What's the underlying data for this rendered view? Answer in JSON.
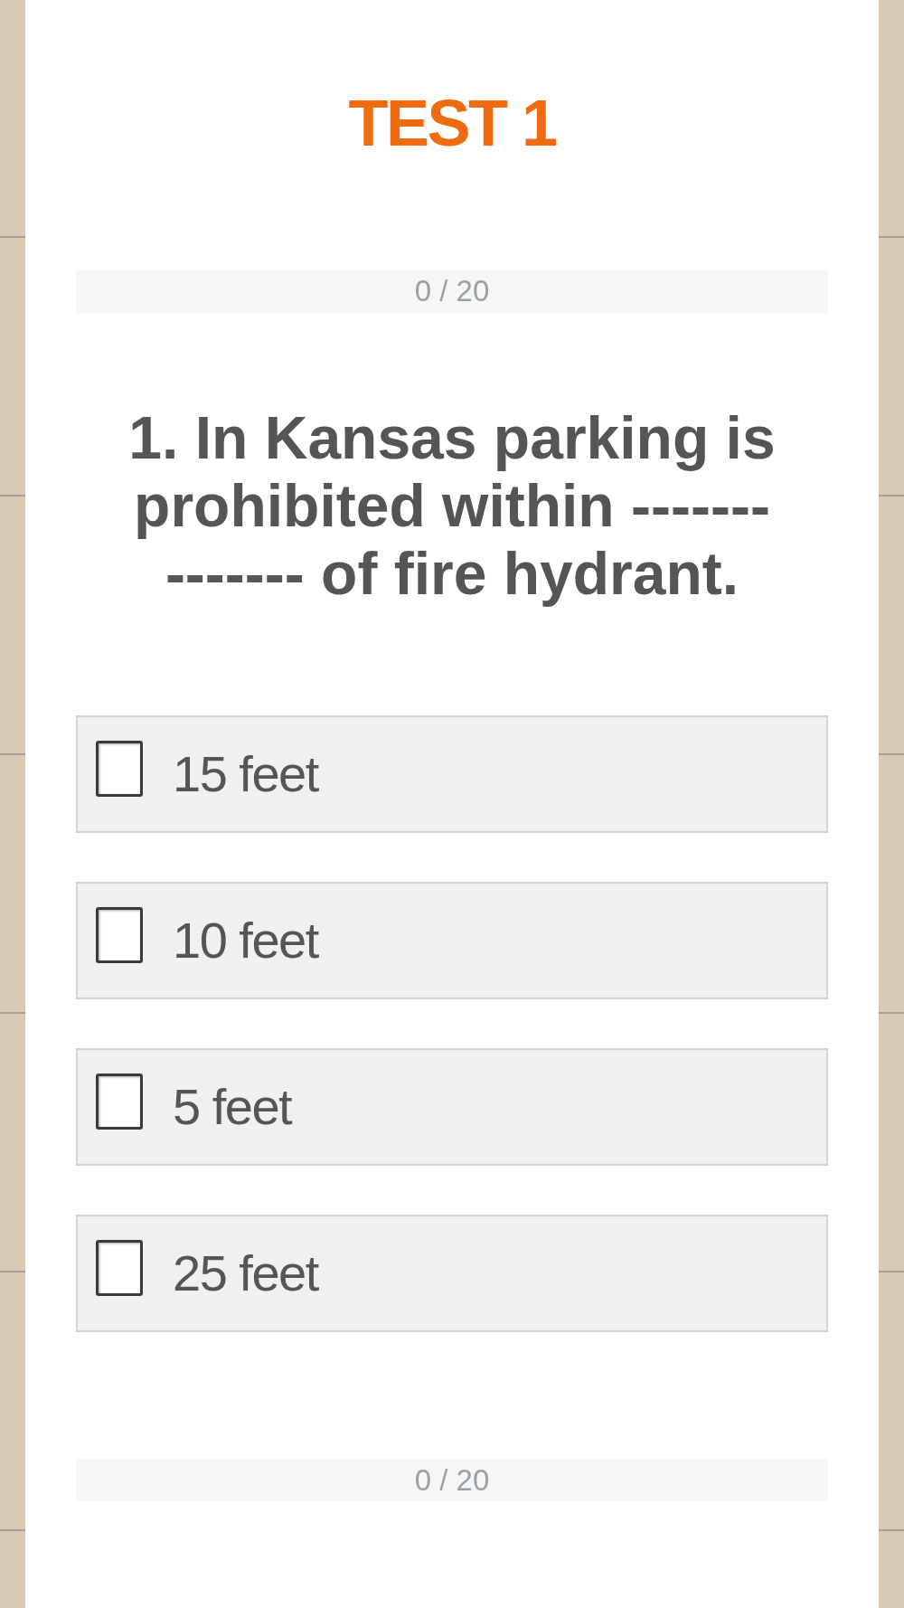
{
  "title": "TEST 1",
  "progress": {
    "text": "0 / 20",
    "level": 0
  },
  "question": "1. In Kansas parking is prohibited within -------------- of fire hydrant.",
  "options": [
    {
      "label": "15 feet",
      "checked": false
    },
    {
      "label": "10 feet",
      "checked": false
    },
    {
      "label": "5 feet",
      "checked": false
    },
    {
      "label": "25 feet",
      "checked": false
    }
  ],
  "footer_progress": {
    "text": "0 / 20",
    "level": 0
  }
}
